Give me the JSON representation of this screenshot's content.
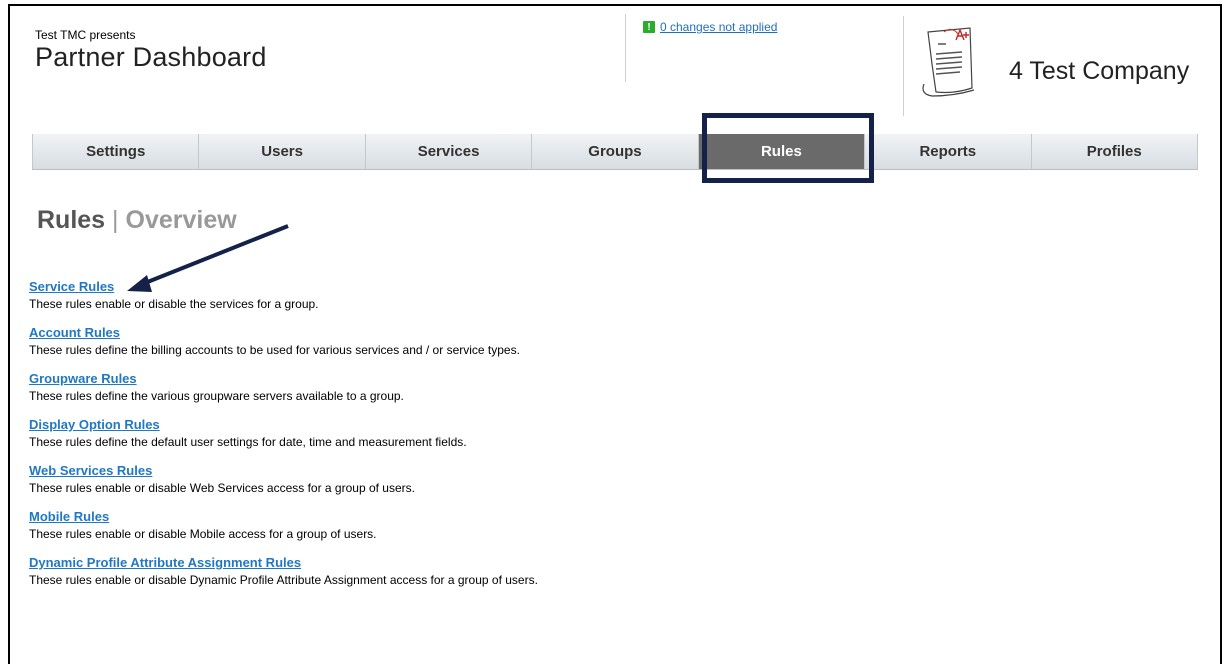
{
  "header": {
    "presents": "Test TMC presents",
    "title": "Partner Dashboard",
    "changes_icon": "!",
    "changes_link": "0 changes not applied",
    "company_name": "4 Test Company",
    "logo_icon": "report-card-a-plus-icon"
  },
  "nav": {
    "tabs": [
      {
        "label": "Settings"
      },
      {
        "label": "Users"
      },
      {
        "label": "Services"
      },
      {
        "label": "Groups"
      },
      {
        "label": "Rules",
        "active": true
      },
      {
        "label": "Reports"
      },
      {
        "label": "Profiles"
      }
    ]
  },
  "page": {
    "title": "Rules",
    "separator": "|",
    "subtitle": "Overview"
  },
  "rules": [
    {
      "link": "Service Rules",
      "description": "These rules enable or disable the services for a group."
    },
    {
      "link": "Account Rules",
      "description": "These rules define the billing accounts to be used for various services and / or service types."
    },
    {
      "link": "Groupware Rules",
      "description": "These rules define the various groupware servers available to a group."
    },
    {
      "link": "Display Option Rules",
      "description": "These rules define the default user settings for date, time and measurement fields."
    },
    {
      "link": "Web Services Rules",
      "description": "These rules enable or disable Web Services access for a group of users."
    },
    {
      "link": "Mobile Rules",
      "description": "These rules enable or disable Mobile access for a group of users."
    },
    {
      "link": "Dynamic Profile Attribute Assignment Rules",
      "description": "These rules enable or disable Dynamic Profile Attribute Assignment access for a group of users."
    }
  ],
  "colors": {
    "link": "#1f78c4",
    "active_tab": "#6a6a6a",
    "highlight": "#14224a",
    "changes_icon": "#2dab2d"
  }
}
